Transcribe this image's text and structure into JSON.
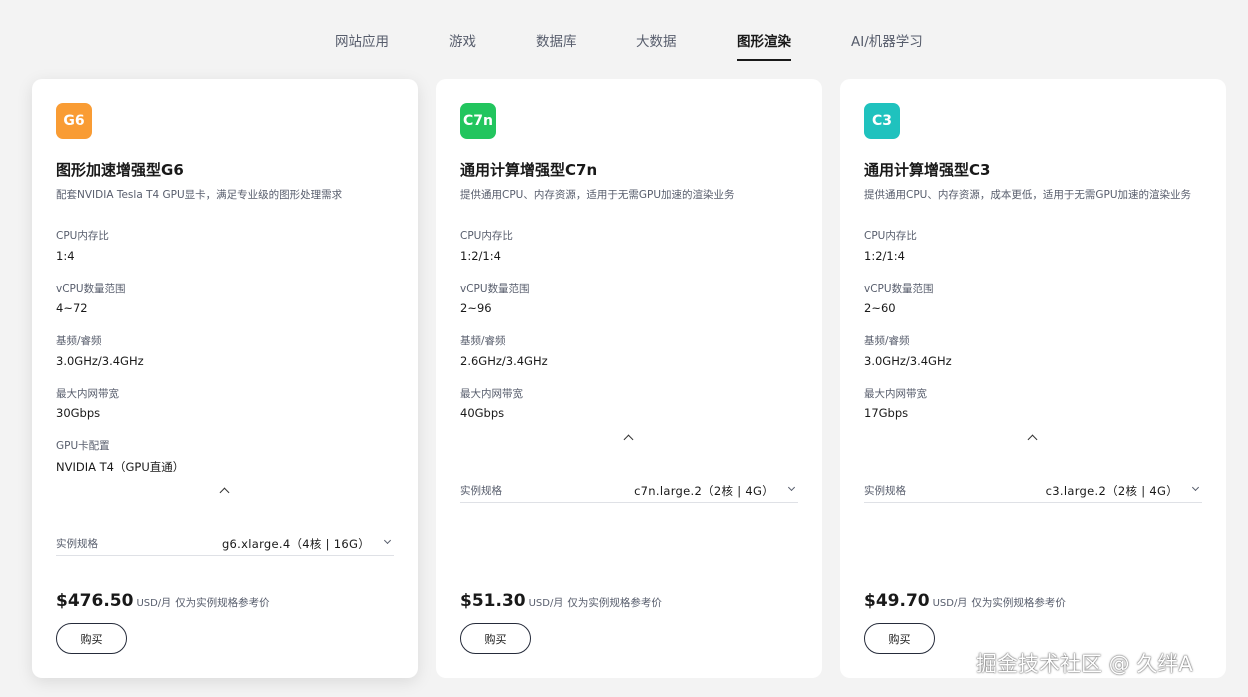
{
  "tabs": [
    {
      "label": "网站应用"
    },
    {
      "label": "游戏"
    },
    {
      "label": "数据库"
    },
    {
      "label": "大数据"
    },
    {
      "label": "图形渲染"
    },
    {
      "label": "AI/机器学习"
    }
  ],
  "active_tab": "图形渲染",
  "cards": [
    {
      "badge": "G6",
      "badge_color": "#f99c34",
      "title": "图形加速增强型G6",
      "desc": "配套NVIDIA Tesla T4 GPU显卡，满足专业级的图形处理需求",
      "specs": [
        {
          "label": "CPU内存比",
          "value": "1:4"
        },
        {
          "label": "vCPU数量范围",
          "value": "4~72"
        },
        {
          "label": "基频/睿频",
          "value": "3.0GHz/3.4GHz"
        },
        {
          "label": "最大内网带宽",
          "value": "30Gbps"
        },
        {
          "label": "GPU卡配置",
          "value": "NVIDIA T4（GPU直通）"
        }
      ],
      "select_label": "实例规格",
      "select_value": "g6.xlarge.4（4核 | 16G）",
      "price": "$476.50",
      "price_unit": "USD/月",
      "price_note": "仅为实例规格参考价",
      "buy_label": "购买"
    },
    {
      "badge": "C7n",
      "badge_color": "#22c55e",
      "title": "通用计算增强型C7n",
      "desc": "提供通用CPU、内存资源，适用于无需GPU加速的渲染业务",
      "specs": [
        {
          "label": "CPU内存比",
          "value": "1:2/1:4"
        },
        {
          "label": "vCPU数量范围",
          "value": "2~96"
        },
        {
          "label": "基频/睿频",
          "value": "2.6GHz/3.4GHz"
        },
        {
          "label": "最大内网带宽",
          "value": "40Gbps"
        }
      ],
      "select_label": "实例规格",
      "select_value": "c7n.large.2（2核 | 4G）",
      "price": "$51.30",
      "price_unit": "USD/月",
      "price_note": "仅为实例规格参考价",
      "buy_label": "购买"
    },
    {
      "badge": "C3",
      "badge_color": "#1fc2be",
      "title": "通用计算增强型C3",
      "desc": "提供通用CPU、内存资源，成本更低，适用于无需GPU加速的渲染业务",
      "specs": [
        {
          "label": "CPU内存比",
          "value": "1:2/1:4"
        },
        {
          "label": "vCPU数量范围",
          "value": "2~60"
        },
        {
          "label": "基频/睿频",
          "value": "3.0GHz/3.4GHz"
        },
        {
          "label": "最大内网带宽",
          "value": "17Gbps"
        }
      ],
      "select_label": "实例规格",
      "select_value": "c3.large.2（2核 | 4G）",
      "price": "$49.70",
      "price_unit": "USD/月",
      "price_note": "仅为实例规格参考价",
      "buy_label": "购买"
    }
  ],
  "watermark": "掘金技术社区 @ 久绊A"
}
